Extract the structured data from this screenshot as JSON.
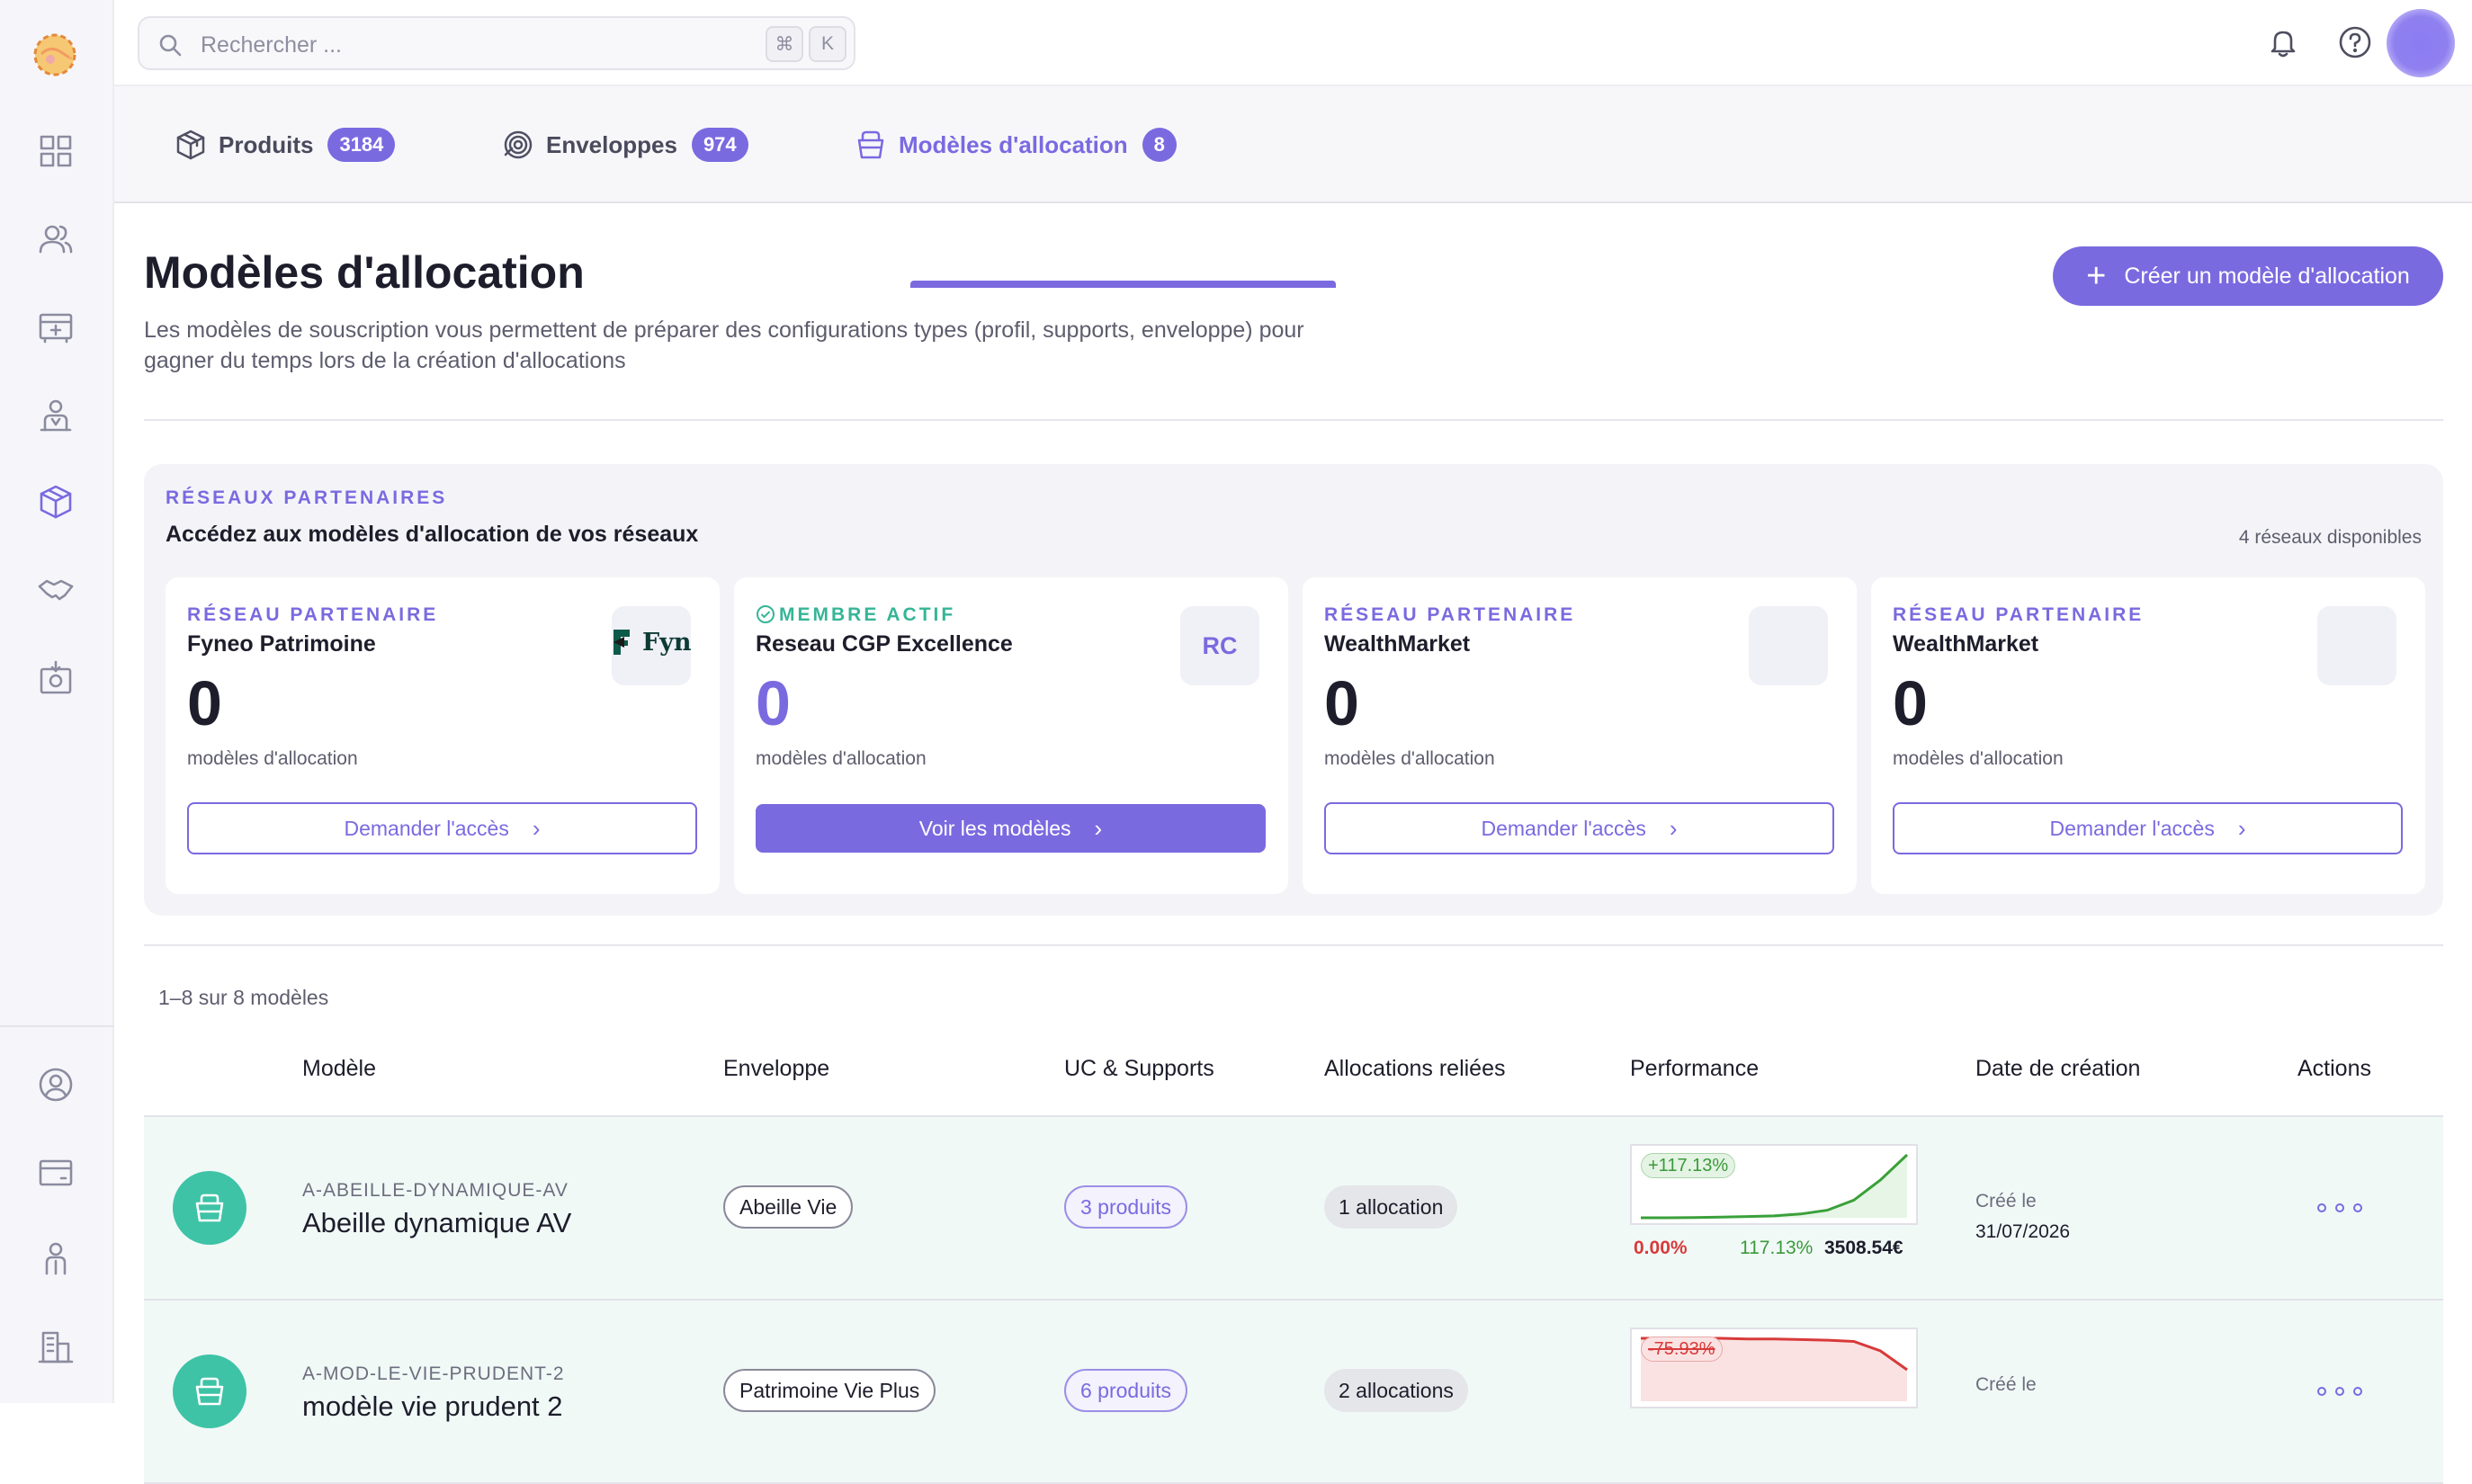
{
  "search": {
    "placeholder": "Rechercher ...",
    "kbd1": "⌘",
    "kbd2": "K"
  },
  "tabs": [
    {
      "label": "Produits",
      "count": "3184"
    },
    {
      "label": "Enveloppes",
      "count": "974"
    },
    {
      "label": "Modèles d'allocation",
      "count": "8"
    }
  ],
  "header": {
    "title": "Modèles d'allocation",
    "description": "Les modèles de souscription vous permettent de préparer des configurations types (profil, supports, enveloppe) pour gagner du temps lors de la création d'allocations",
    "create_label": "Créer un modèle d'allocation"
  },
  "networks": {
    "kicker": "RÉSEAUX PARTENAIRES",
    "title": "Accédez aux modèles d'allocation de vos réseaux",
    "available": "4 réseaux disponibles",
    "cards": [
      {
        "kicker": "RÉSEAU PARTENAIRE",
        "name": "Fyneo Patrimoine",
        "count": "0",
        "sub": "modèles d'allocation",
        "button": "Demander l'accès",
        "logo_text": "Fyn"
      },
      {
        "kicker": "MEMBRE ACTIF",
        "name": "Reseau CGP Excellence",
        "count": "0",
        "sub": "modèles d'allocation",
        "button": "Voir les modèles",
        "logo_text": "RC"
      },
      {
        "kicker": "RÉSEAU PARTENAIRE",
        "name": "WealthMarket",
        "count": "0",
        "sub": "modèles d'allocation",
        "button": "Demander l'accès"
      },
      {
        "kicker": "RÉSEAU PARTENAIRE",
        "name": "WealthMarket",
        "count": "0",
        "sub": "modèles d'allocation",
        "button": "Demander l'accès"
      }
    ]
  },
  "list": {
    "count_label": "1–8 sur 8 modèles",
    "columns": [
      "Modèle",
      "Enveloppe",
      "UC & Supports",
      "Allocations reliées",
      "Performance",
      "Date de création",
      "Actions"
    ],
    "rows": [
      {
        "code": "A-ABEILLE-DYNAMIQUE-AV",
        "name": "Abeille dynamique AV",
        "envelope": "Abeille Vie",
        "uc": "3 produits",
        "allocations": "1 allocation",
        "perf_tag": "+117.13%",
        "perf_start": "0.00%",
        "perf_end": "117.13%",
        "perf_value": "3508.54€",
        "date_label": "Créé le",
        "date": "31/07/2026",
        "trend": [
          0,
          0,
          0.5,
          1,
          2,
          3,
          6,
          12,
          28,
          60,
          100
        ]
      },
      {
        "code": "A-MOD-LE-VIE-PRUDENT-2",
        "name": "modèle vie prudent 2",
        "envelope": "Patrimoine Vie Plus",
        "uc": "6 produits",
        "allocations": "2 allocations",
        "perf_tag": "-75.93%",
        "date_label": "Créé le",
        "trend": [
          100,
          100,
          100,
          100,
          99,
          99,
          98,
          97,
          95,
          80,
          50
        ]
      }
    ]
  },
  "colors": {
    "accent": "#7a6ae0",
    "teal": "#3ec3a6",
    "positive": "#3a9a3a",
    "negative": "#d83a3a"
  }
}
